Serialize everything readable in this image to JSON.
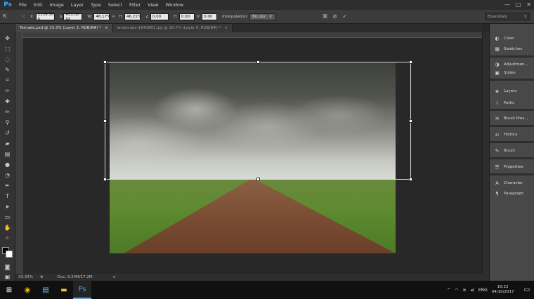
{
  "app": {
    "logo": "Ps",
    "menu": [
      "File",
      "Edit",
      "Image",
      "Layer",
      "Type",
      "Select",
      "Filter",
      "View",
      "Window"
    ],
    "window_controls": [
      "—",
      "□",
      "✕"
    ]
  },
  "options": {
    "x_label": "X:",
    "x_value": "1139.50 p",
    "y_value": "451.00 px",
    "w_label": "W:",
    "w_value": "46.17%",
    "h_label": "H:",
    "h_value": "46.21%",
    "angle_value": "0.00",
    "hskew_label": "H:",
    "hskew_value": "0.00",
    "vskew_label": "V:",
    "vskew_value": "0.00",
    "interpolation_label": "Interpolation:",
    "interpolation_value": "Bicubic",
    "workspace": "Essentials"
  },
  "tabs": [
    {
      "label": "Tornado.psd @ 33.3% (Layer 2, RGB/8#) *",
      "close": "×"
    },
    {
      "label": "landscape-1640881.jpg @ 16.7% (Layer 0, RGB/8#) *",
      "close": "×"
    }
  ],
  "panels": [
    {
      "label": "Color",
      "icon": "color-wheel-icon"
    },
    {
      "label": "Swatches",
      "icon": "swatches-icon"
    },
    {
      "label": "Adjustmen...",
      "icon": "adjustments-icon"
    },
    {
      "label": "Styles",
      "icon": "styles-icon"
    },
    {
      "label": "Layers",
      "icon": "layers-icon"
    },
    {
      "label": "Paths",
      "icon": "paths-icon"
    },
    {
      "label": "Brush Pres...",
      "icon": "brush-presets-icon"
    },
    {
      "label": "History",
      "icon": "history-icon"
    },
    {
      "label": "Brush",
      "icon": "brush-icon"
    },
    {
      "label": "Properties",
      "icon": "properties-icon"
    },
    {
      "label": "Character",
      "icon": "character-icon"
    },
    {
      "label": "Paragraph",
      "icon": "paragraph-icon"
    }
  ],
  "status": {
    "zoom": "33.33%",
    "doc": "Doc: 9.24M/17.2M"
  },
  "taskbar": {
    "language": "ENG",
    "time": "10:22",
    "date": "04/10/2017"
  },
  "colors": {
    "foreground": "#000000",
    "background": "#ffffff",
    "accent": "#31a8ff"
  }
}
